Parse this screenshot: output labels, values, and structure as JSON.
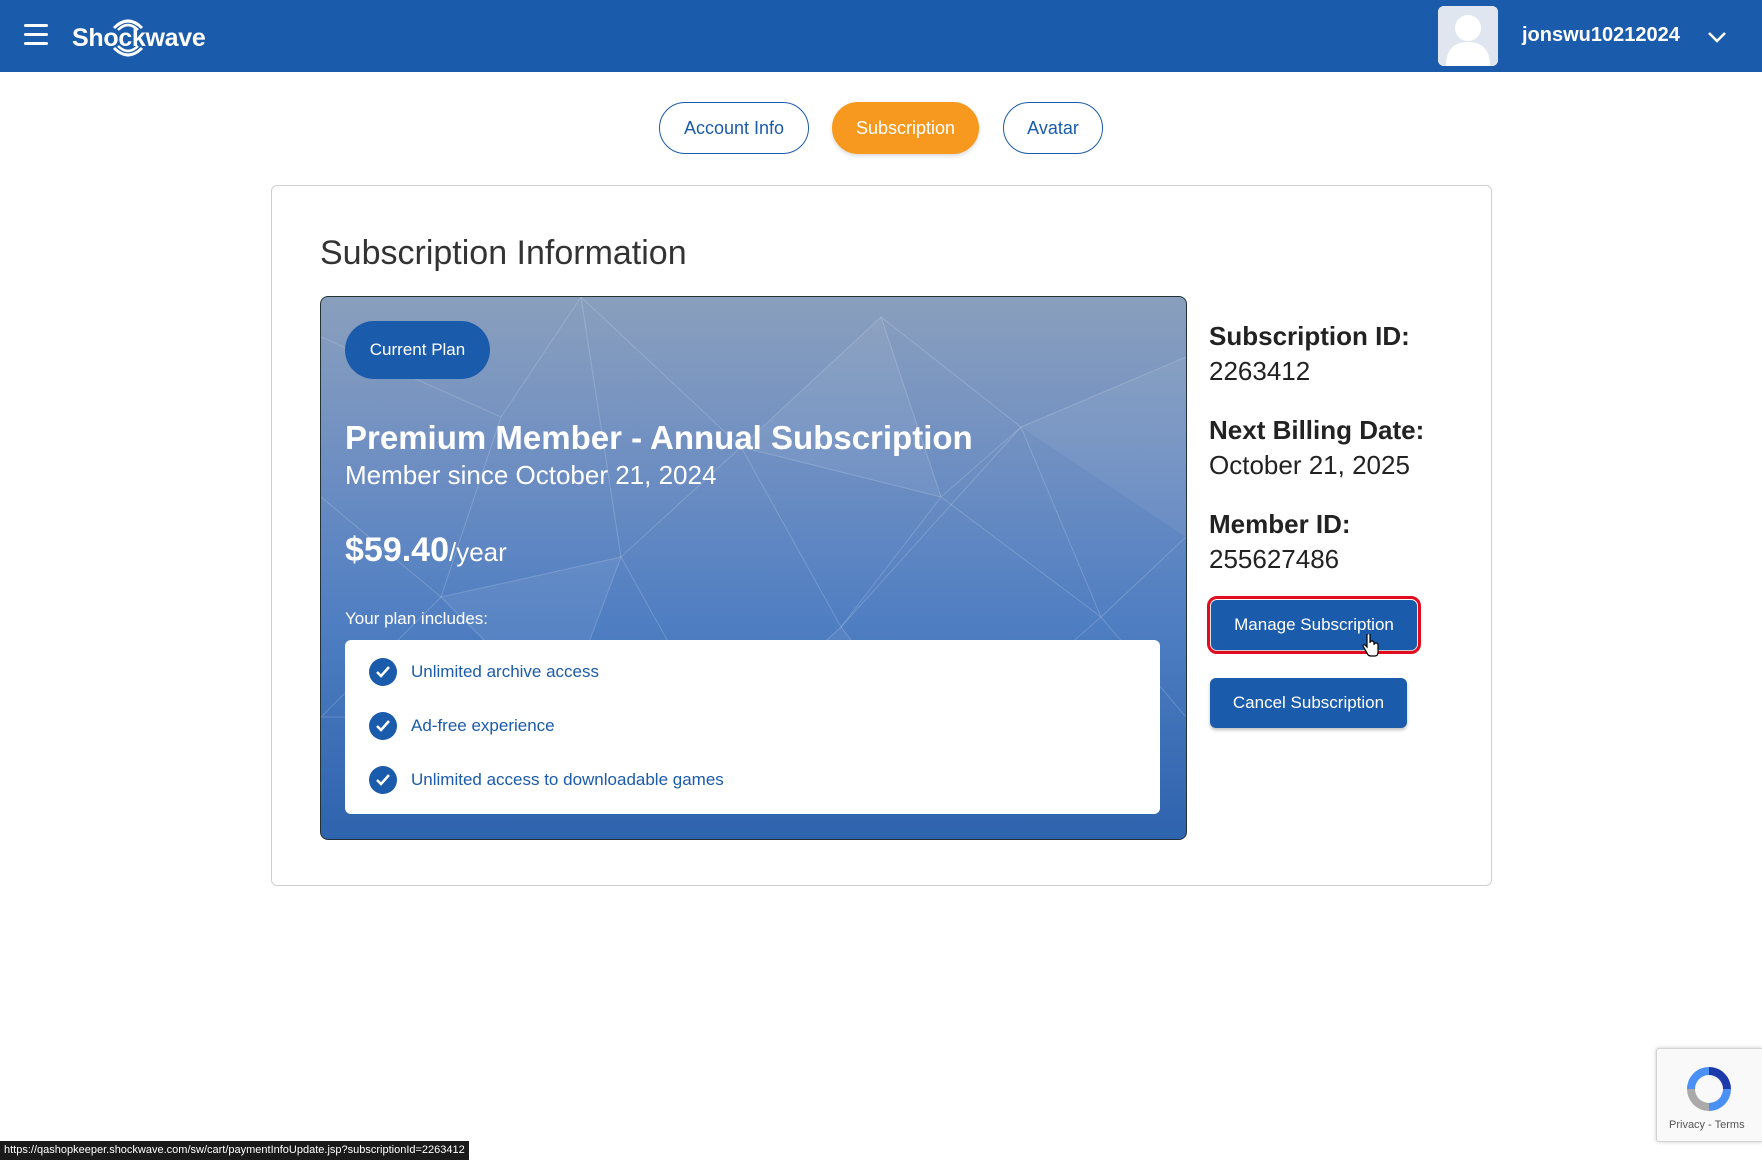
{
  "header": {
    "menu_icon": "hamburger-menu-icon",
    "brand": "Shockwave",
    "username": "jonswu10212024",
    "user_menu_icon": "chevron-down-icon",
    "color": "#1b5bab"
  },
  "tabs": [
    {
      "label": "Account Info",
      "active": false
    },
    {
      "label": "Subscription",
      "active": true
    },
    {
      "label": "Avatar",
      "active": false
    }
  ],
  "subscription": {
    "title": "Subscription Information",
    "badge": "Current Plan",
    "plan_name": "Premium Member - Annual Subscription",
    "member_since": "Member since October 21, 2024",
    "price": "$59.40",
    "period": "/year",
    "includes_label": "Your plan includes:",
    "features": [
      "Unlimited archive access",
      "Ad-free experience",
      "Unlimited access to downloadable games"
    ]
  },
  "info": {
    "subscription_id_label": "Subscription ID:",
    "subscription_id": "2263412",
    "next_billing_label": "Next Billing Date:",
    "next_billing": "October 21, 2025",
    "member_id_label": "Member ID:",
    "member_id": "255627486"
  },
  "actions": {
    "manage": "Manage Subscription",
    "cancel": "Cancel Subscription"
  },
  "status_url": "https://qashopkeeper.shockwave.com/sw/cart/paymentInfoUpdate.jsp?subscriptionId=2263412",
  "recaptcha": {
    "privacy": "Privacy",
    "separator": " - ",
    "terms": "Terms"
  },
  "colors": {
    "accent": "#f7991f",
    "primary": "#1b5bab",
    "highlight": "#e10d1f"
  }
}
